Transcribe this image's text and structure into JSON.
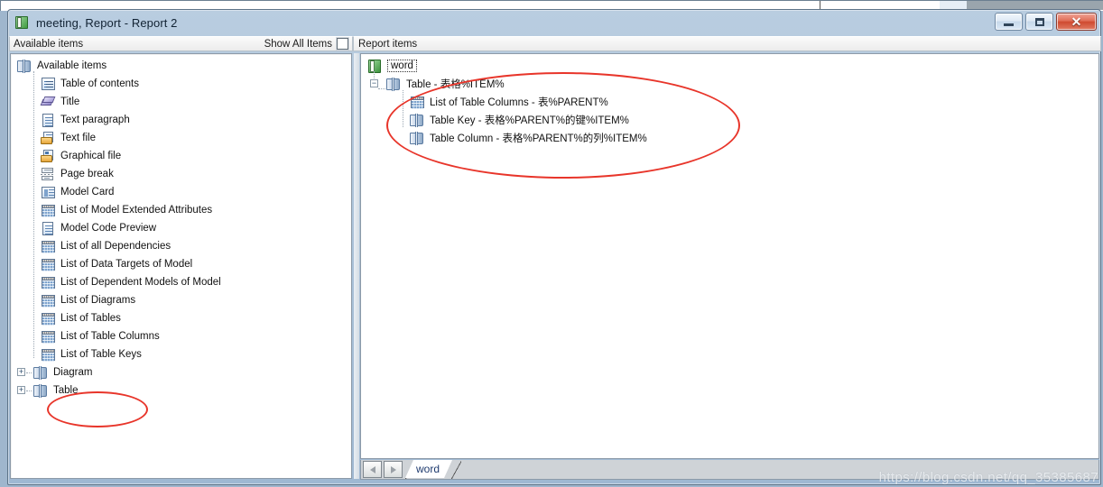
{
  "window": {
    "title": "meeting, Report - Report 2",
    "icon": "green-book-icon",
    "buttons": {
      "minimize": "minimize-button",
      "maximize": "maximize-button",
      "close_glyph": "✕"
    }
  },
  "header": {
    "left_caption": "Available items",
    "show_all_label": "Show All Items",
    "show_all_checked": false,
    "right_caption": "Report items"
  },
  "available_items_tree": {
    "root": {
      "label": "Available items",
      "icon": "books-icon",
      "indent": 0
    },
    "children": [
      {
        "label": "Table of contents",
        "icon": "toc-icon"
      },
      {
        "label": "Title",
        "icon": "title-icon"
      },
      {
        "label": "Text paragraph",
        "icon": "document-icon"
      },
      {
        "label": "Text file",
        "icon": "text-file-icon"
      },
      {
        "label": "Graphical file",
        "icon": "graphical-file-icon"
      },
      {
        "label": "Page break",
        "icon": "page-break-icon"
      },
      {
        "label": "Model Card",
        "icon": "model-card-icon"
      },
      {
        "label": "List of Model Extended Attributes",
        "icon": "grid-list-icon"
      },
      {
        "label": "Model Code Preview",
        "icon": "document-icon"
      },
      {
        "label": "List of all Dependencies",
        "icon": "grid-list-icon"
      },
      {
        "label": "List of Data Targets of Model",
        "icon": "grid-list-icon"
      },
      {
        "label": "List of Dependent Models of Model",
        "icon": "grid-list-icon"
      },
      {
        "label": "List of Diagrams",
        "icon": "grid-list-icon"
      },
      {
        "label": "List of Tables",
        "icon": "grid-list-icon"
      },
      {
        "label": "List of Table Columns",
        "icon": "grid-list-icon"
      },
      {
        "label": "List of Table Keys",
        "icon": "grid-list-icon"
      }
    ],
    "collapsed_groups": [
      {
        "label": "Diagram",
        "icon": "books-icon",
        "expander": "+"
      },
      {
        "label": "Table",
        "icon": "books-icon",
        "expander": "+"
      }
    ]
  },
  "report_items_tree": {
    "root": {
      "label": "word",
      "icon": "green-book-icon",
      "selected": true
    },
    "table_node": {
      "label": "Table - 表格%ITEM%",
      "icon": "books-icon",
      "expander": "−"
    },
    "table_children": [
      {
        "label": "List of Table Columns - 表%PARENT%",
        "icon": "grid-list-icon"
      },
      {
        "label": "Table Key - 表格%PARENT%的键%ITEM%",
        "icon": "books-icon"
      },
      {
        "label": "Table Column - 表格%PARENT%的列%ITEM%",
        "icon": "books-icon"
      }
    ]
  },
  "tabstrip": {
    "prev_label": "◀",
    "next_label": "▶",
    "tabs": [
      {
        "label": "word",
        "active": true
      }
    ]
  },
  "annotations": {
    "ellipse_color": "#e8352a",
    "count": 2
  },
  "watermark": "https://blog.csdn.net/qq_35385687"
}
